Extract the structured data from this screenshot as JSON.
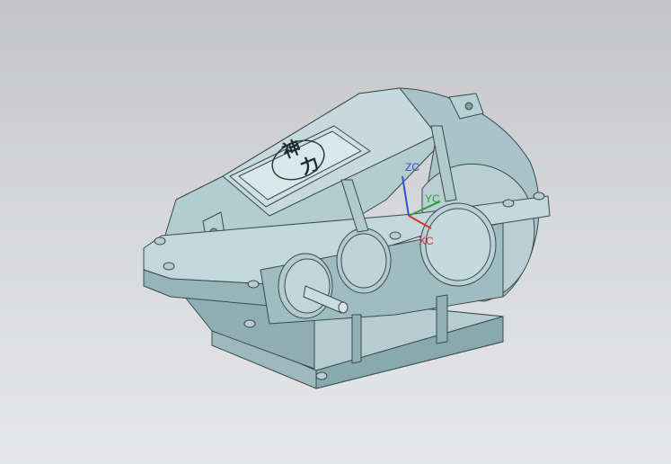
{
  "viewport": {
    "background_top": "#c3c4c6",
    "background_bottom": "#e6e7e9"
  },
  "model": {
    "body_color": "#a9c4c8",
    "shade_color": "#86a5aa",
    "light_color": "#c6dadd",
    "edge_color": "#3a4a4d",
    "nameplate_text": [
      "神",
      "力"
    ]
  },
  "triad": {
    "zc_label": "ZC",
    "yc_label": "YC",
    "xc_label": "XC",
    "zc_color": "#2f4fd8",
    "yc_color": "#2f9a3c",
    "xc_color": "#d83030"
  }
}
